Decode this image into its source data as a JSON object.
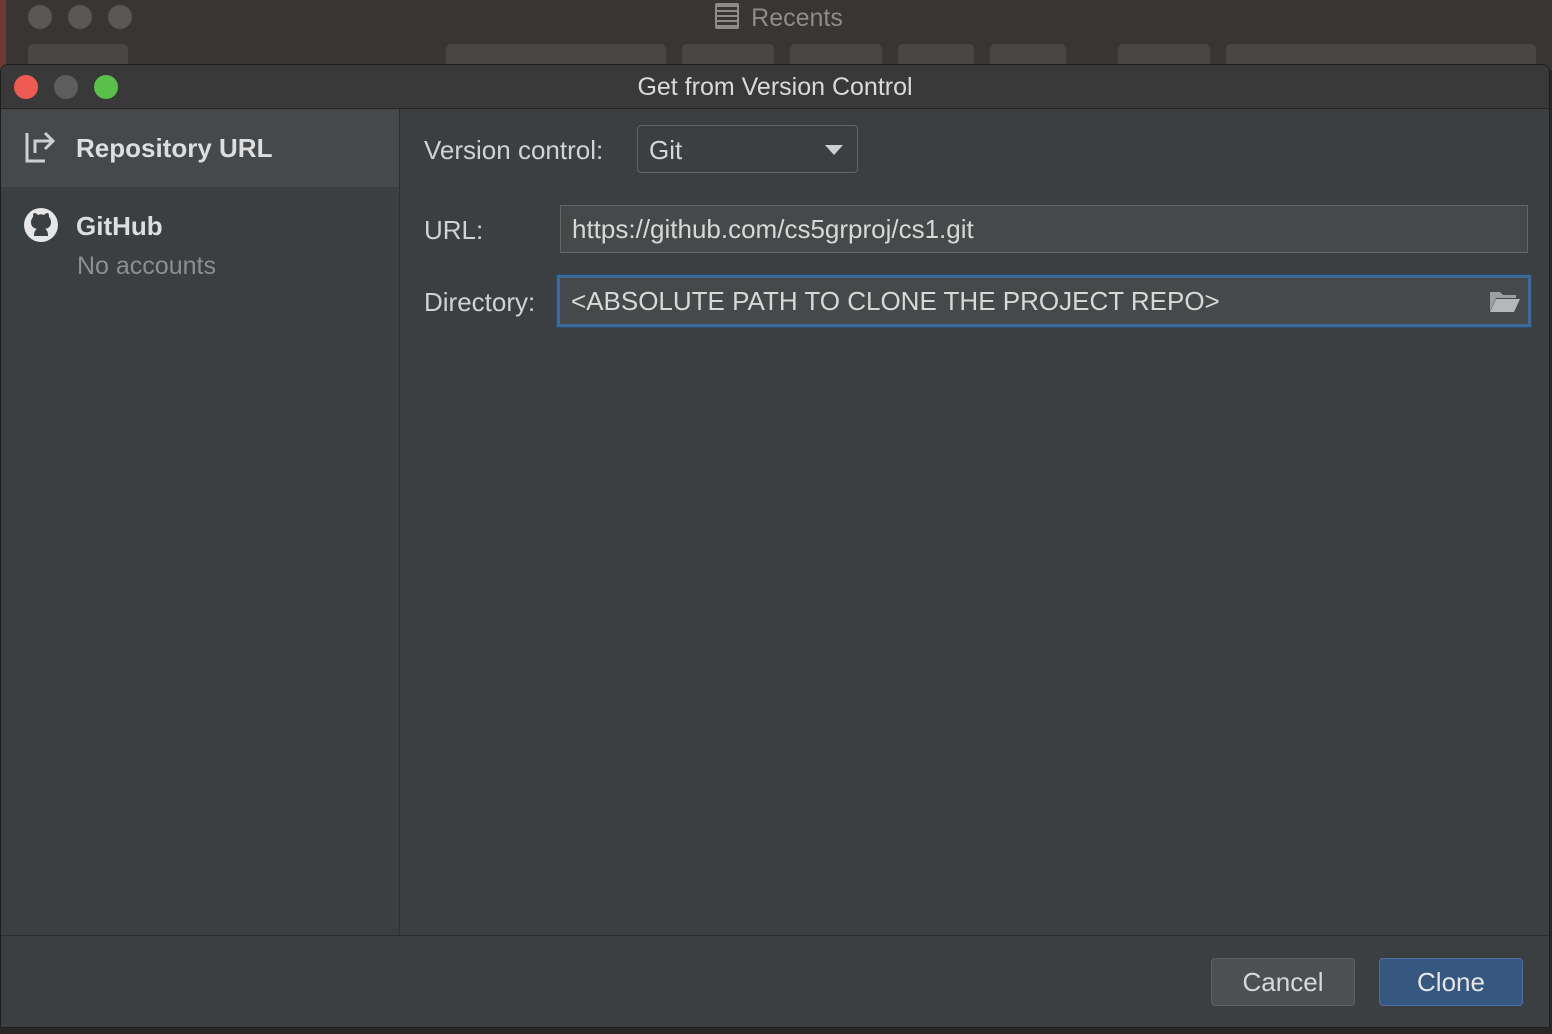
{
  "background_window": {
    "title": "Recents",
    "title_icon": "document-icon"
  },
  "dialog": {
    "title": "Get from Version Control"
  },
  "sidebar": {
    "items": [
      {
        "label": "Repository URL",
        "icon": "repository-url-icon",
        "selected": true
      },
      {
        "label": "GitHub",
        "sub": "No accounts",
        "icon": "github-icon",
        "selected": false
      }
    ]
  },
  "form": {
    "version_control": {
      "label": "Version control:",
      "value": "Git"
    },
    "url": {
      "label": "URL:",
      "value": "https://github.com/cs5grproj/cs1.git"
    },
    "directory": {
      "label": "Directory:",
      "value": "<ABSOLUTE PATH TO CLONE THE PROJECT REPO>",
      "icon": "folder-open-icon"
    }
  },
  "footer": {
    "cancel_label": "Cancel",
    "clone_label": "Clone"
  },
  "colors": {
    "accent": "#365880",
    "focus_border": "#3d6a96",
    "close": "#ee5b52",
    "zoom": "#5bbf4b"
  }
}
